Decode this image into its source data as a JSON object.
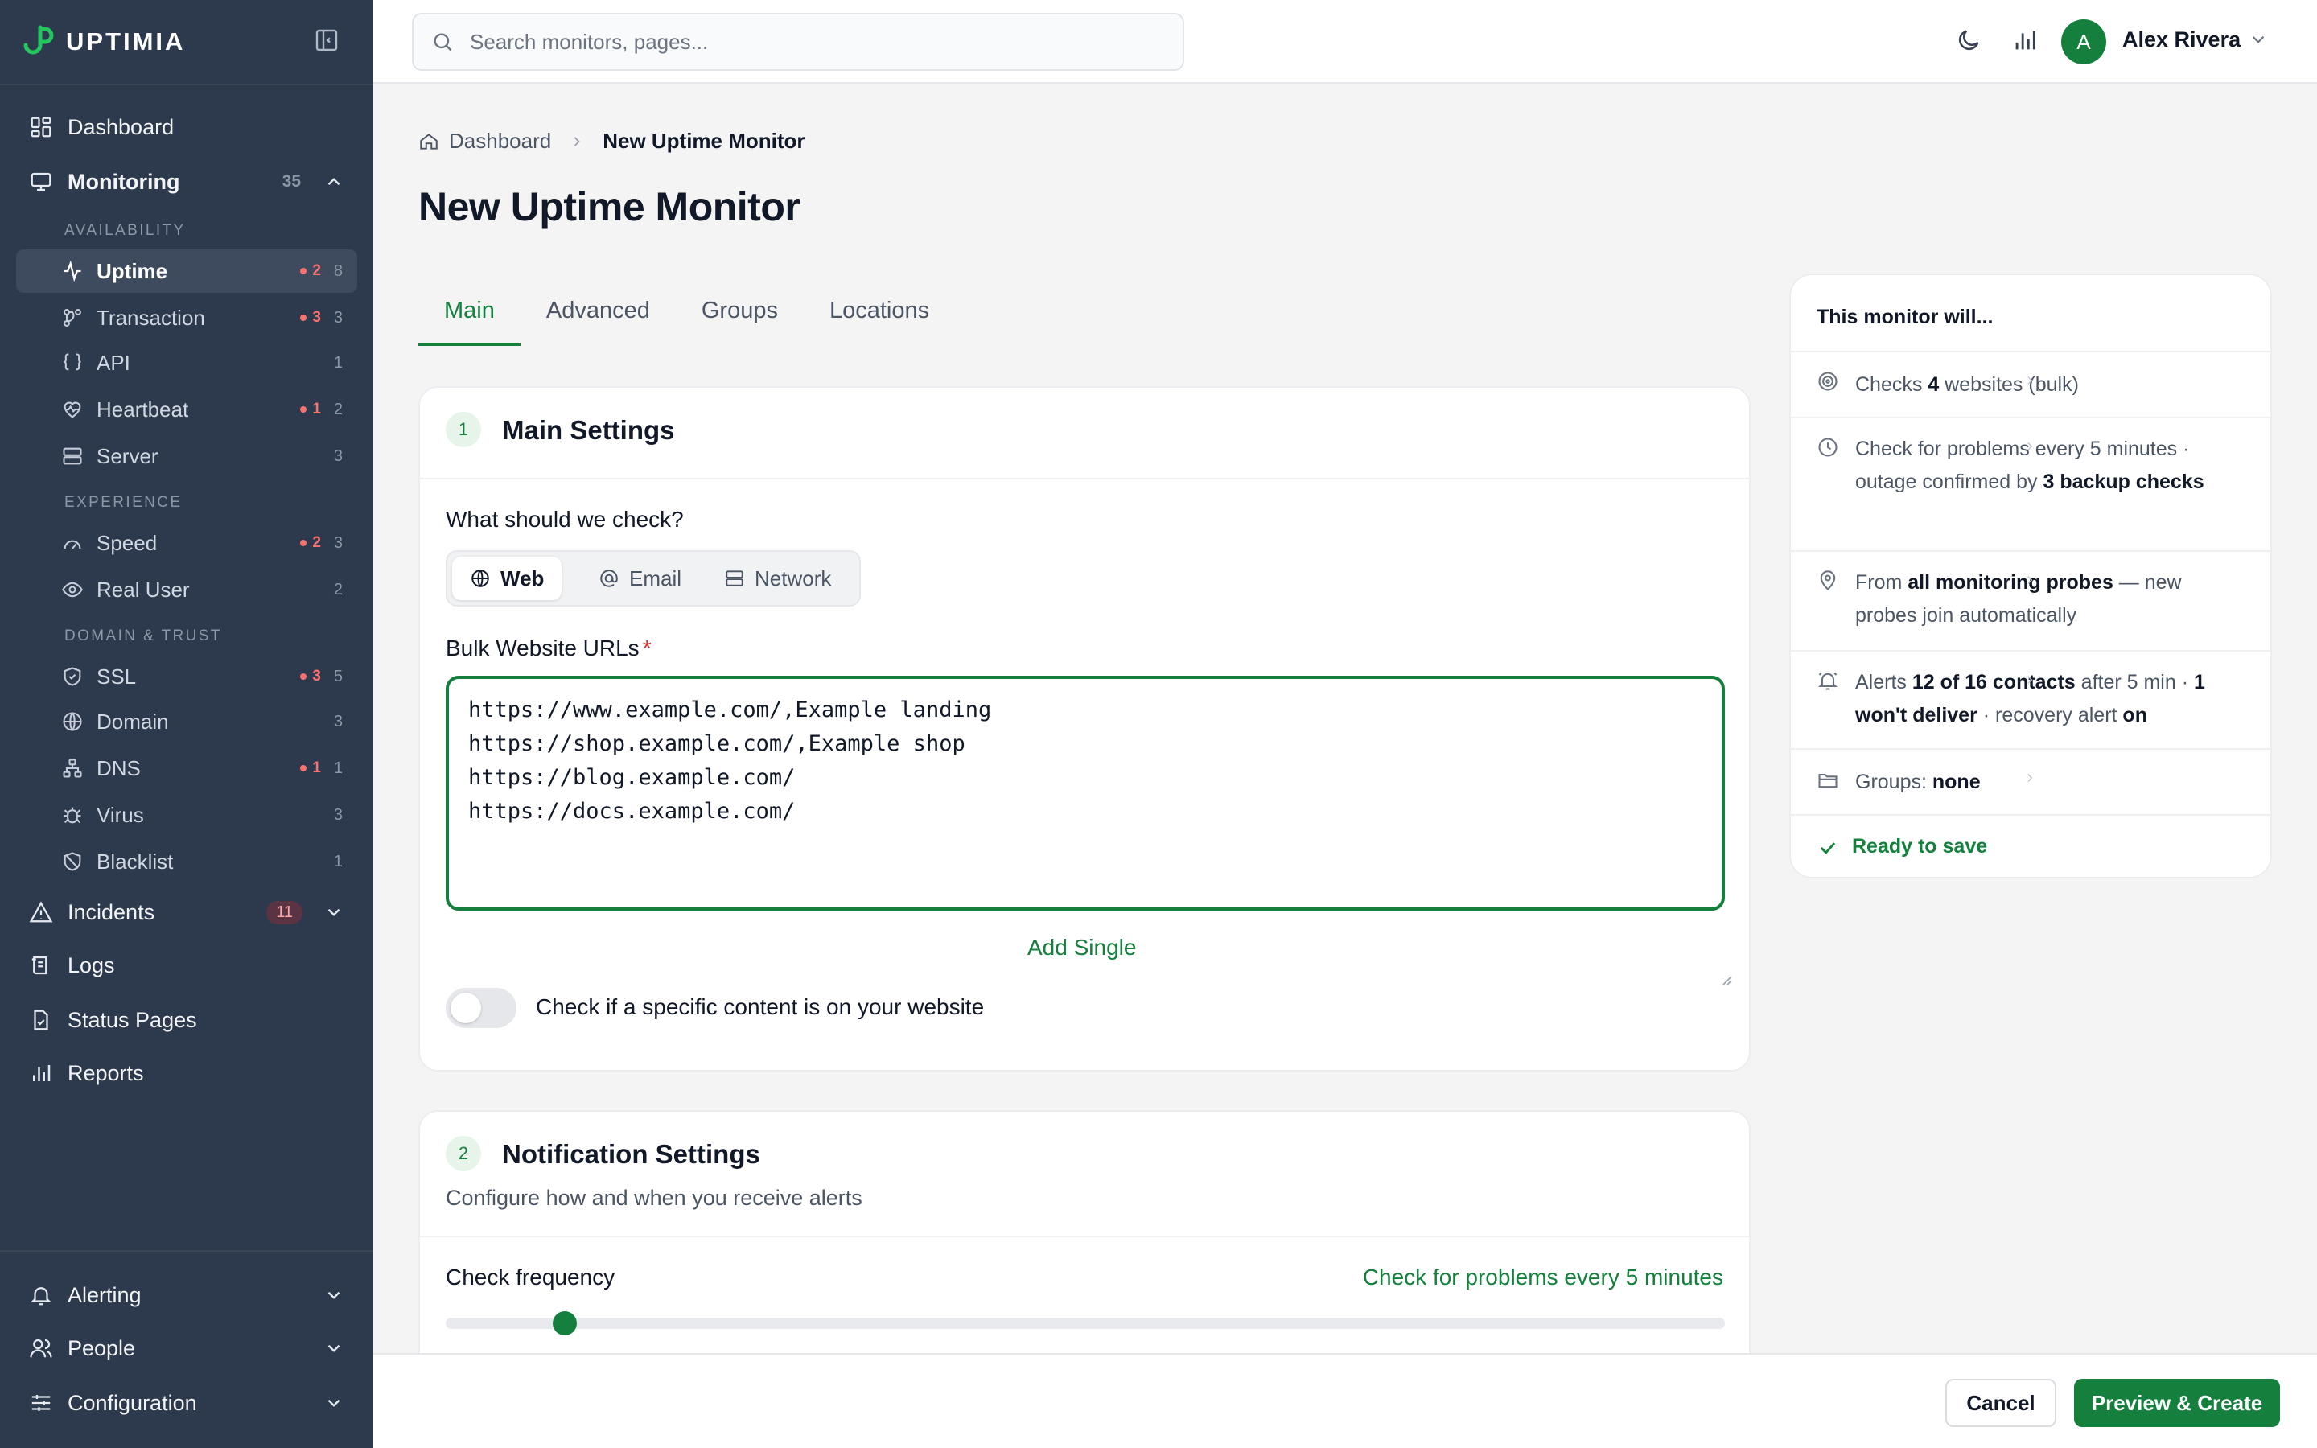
{
  "app": {
    "name": "UPTIMIA"
  },
  "sidebar": {
    "dashboard": "Dashboard",
    "monitoring": {
      "label": "Monitoring",
      "count": "35"
    },
    "sections": {
      "availability": "AVAILABILITY",
      "experience": "EXPERIENCE",
      "domain_trust": "DOMAIN & TRUST"
    },
    "items": [
      {
        "label": "Uptime",
        "alert": "2",
        "count": "8",
        "icon": "pulse-icon"
      },
      {
        "label": "Transaction",
        "alert": "3",
        "count": "3",
        "icon": "flow-icon"
      },
      {
        "label": "API",
        "alert": "",
        "count": "1",
        "icon": "braces-icon"
      },
      {
        "label": "Heartbeat",
        "alert": "1",
        "count": "2",
        "icon": "heart-pulse-icon"
      },
      {
        "label": "Server",
        "alert": "",
        "count": "3",
        "icon": "server-icon"
      },
      {
        "label": "Speed",
        "alert": "2",
        "count": "3",
        "icon": "gauge-icon"
      },
      {
        "label": "Real User",
        "alert": "",
        "count": "2",
        "icon": "eye-icon"
      },
      {
        "label": "SSL",
        "alert": "3",
        "count": "5",
        "icon": "shield-icon"
      },
      {
        "label": "Domain",
        "alert": "",
        "count": "3",
        "icon": "globe-icon"
      },
      {
        "label": "DNS",
        "alert": "1",
        "count": "1",
        "icon": "network-icon"
      },
      {
        "label": "Virus",
        "alert": "",
        "count": "3",
        "icon": "bug-icon"
      },
      {
        "label": "Blacklist",
        "alert": "",
        "count": "1",
        "icon": "shield-off-icon"
      }
    ],
    "incidents": {
      "label": "Incidents",
      "count": "11"
    },
    "logs": "Logs",
    "status_pages": "Status Pages",
    "reports": "Reports",
    "alerting": "Alerting",
    "people": "People",
    "configuration": "Configuration"
  },
  "topbar": {
    "search_placeholder": "Search monitors, pages...",
    "user": {
      "initial": "A",
      "name": "Alex Rivera"
    }
  },
  "breadcrumb": {
    "home": "Dashboard",
    "current": "New Uptime Monitor"
  },
  "page_title": "New Uptime Monitor",
  "tabs": [
    "Main",
    "Advanced",
    "Groups",
    "Locations"
  ],
  "main_settings": {
    "step": "1",
    "title": "Main Settings",
    "question": "What should we check?",
    "types": [
      "Web",
      "Email",
      "Network"
    ],
    "urls_label": "Bulk Website URLs",
    "required_mark": "*",
    "urls_value": "https://www.example.com/,Example landing\nhttps://shop.example.com/,Example shop\nhttps://blog.example.com/\nhttps://docs.example.com/",
    "add_single": "Add Single",
    "content_check_label": "Check if a specific content is on your website",
    "content_check_enabled": false
  },
  "notification_settings": {
    "step": "2",
    "title": "Notification Settings",
    "subtitle": "Configure how and when you receive alerts",
    "frequency_label": "Check frequency",
    "frequency_value": "Check for problems every 5 minutes",
    "slider_fraction": 0.085
  },
  "summary": {
    "title": "This monitor will...",
    "rows": [
      {
        "icon": "target-icon",
        "a": "Checks ",
        "b": "4",
        "c": " websites (bulk)",
        "d": "",
        "e": "",
        "f": ""
      },
      {
        "icon": "clock-icon",
        "a": "Check for problems every 5 minutes · outage confirmed by ",
        "b": "3 backup checks",
        "c": "",
        "d": "",
        "e": "",
        "f": ""
      },
      {
        "icon": "pin-icon",
        "a": "From ",
        "b": "all monitoring probes",
        "c": " — new probes join automatically",
        "d": "",
        "e": "",
        "f": ""
      },
      {
        "icon": "bell-icon",
        "a": "Alerts ",
        "b": "12 of 16 contacts",
        "c": " after 5 min · ",
        "d": "1 won't deliver",
        "e": " · recovery alert ",
        "f": "on"
      },
      {
        "icon": "folder-icon",
        "a": "Groups: ",
        "b": "none",
        "c": "",
        "d": "",
        "e": "",
        "f": ""
      }
    ],
    "ready": "Ready to save"
  },
  "footer": {
    "cancel": "Cancel",
    "primary": "Preview & Create"
  },
  "colors": {
    "accent": "#15803d",
    "sidebar_bg": "#2d3a4e",
    "alert": "#f87171"
  }
}
